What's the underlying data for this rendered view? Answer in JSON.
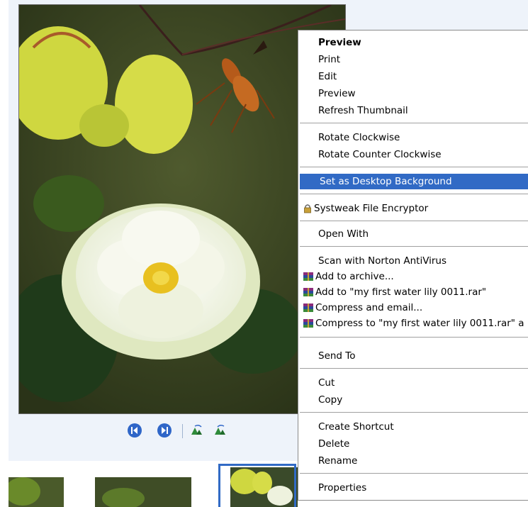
{
  "context_menu": {
    "items": [
      {
        "label": "Preview"
      },
      {
        "label": "Print"
      },
      {
        "label": "Edit"
      },
      {
        "label": "Preview"
      },
      {
        "label": "Refresh Thumbnail"
      },
      {
        "label": "Rotate Clockwise"
      },
      {
        "label": "Rotate Counter Clockwise"
      },
      {
        "label": "Set as Desktop Background"
      },
      {
        "label": "Systweak File Encryptor"
      },
      {
        "label": "Open With"
      },
      {
        "label": "Scan with Norton AntiVirus"
      },
      {
        "label": "Add to archive..."
      },
      {
        "label": "Add to \"my first water lily 0011.rar\""
      },
      {
        "label": "Compress and email..."
      },
      {
        "label": "Compress to \"my first water lily 0011.rar\" a"
      },
      {
        "label": "Send To"
      },
      {
        "label": "Cut"
      },
      {
        "label": "Copy"
      },
      {
        "label": "Create Shortcut"
      },
      {
        "label": "Delete"
      },
      {
        "label": "Rename"
      },
      {
        "label": "Properties"
      }
    ],
    "selected_index": 7,
    "bold_index": 0
  },
  "toolbar": {
    "buttons": [
      "previous-image-icon",
      "next-image-icon",
      "rotate-clockwise-icon",
      "rotate-counterclockwise-icon"
    ]
  },
  "icons": {
    "lock": "lock-icon",
    "archive": "winrar-archive-icon"
  },
  "colors": {
    "selection": "#316ac5",
    "viewer_background": "#eef3fa",
    "toolbar_button": "#2f66c8"
  }
}
